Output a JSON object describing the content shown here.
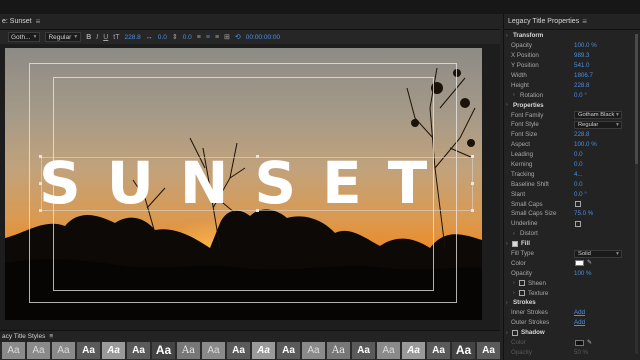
{
  "title_panel": {
    "tab_label": "e: Sunset",
    "menu_glyph": "≡"
  },
  "toolbar": {
    "font_family": "Goth...",
    "font_style": "Regular",
    "bold": "B",
    "italic": "I",
    "underline": "U",
    "font_size_icon": "tT",
    "font_size": "228.8",
    "kerning": "0.0",
    "leading": "0.0",
    "timecode": "00:00:00:00"
  },
  "canvas": {
    "title_text": "SUNSET"
  },
  "styles_panel": {
    "tab_label": "acy Title Styles",
    "menu_glyph": "≡",
    "swatches": [
      "Aa",
      "Aa",
      "Aa",
      "Aa",
      "Aa",
      "Aa",
      "Aa",
      "Aa",
      "Aa",
      "Aa",
      "Aa",
      "Aa",
      "Aa",
      "Aa",
      "Aa",
      "Aa",
      "Aa",
      "Aa",
      "Aa",
      "Aa"
    ]
  },
  "properties_panel": {
    "title": "Legacy Title Properties",
    "menu_glyph": "≡",
    "rows": [
      {
        "kind": "section",
        "label": "Transform"
      },
      {
        "kind": "value",
        "label": "Opacity",
        "value": "100.0 %"
      },
      {
        "kind": "value",
        "label": "X Position",
        "value": "989.3"
      },
      {
        "kind": "value",
        "label": "Y Position",
        "value": "541.0"
      },
      {
        "kind": "value",
        "label": "Width",
        "value": "1806.7"
      },
      {
        "kind": "value",
        "label": "Height",
        "value": "228.8"
      },
      {
        "kind": "twisty",
        "label": "Rotation",
        "value": "0.0 °"
      },
      {
        "kind": "section",
        "label": "Properties"
      },
      {
        "kind": "select",
        "label": "Font Family",
        "value": "Gotham Black"
      },
      {
        "kind": "select",
        "label": "Font Style",
        "value": "Regular"
      },
      {
        "kind": "value",
        "label": "Font Size",
        "value": "228.8"
      },
      {
        "kind": "value",
        "label": "Aspect",
        "value": "100.0 %"
      },
      {
        "kind": "value",
        "label": "Leading",
        "value": "0.0"
      },
      {
        "kind": "value",
        "label": "Kerning",
        "value": "0.0"
      },
      {
        "kind": "value",
        "label": "Tracking",
        "value": "4..."
      },
      {
        "kind": "value",
        "label": "Baseline Shift",
        "value": "0.0"
      },
      {
        "kind": "value",
        "label": "Slant",
        "value": "0.0 °"
      },
      {
        "kind": "check",
        "label": "Small Caps",
        "checked": false
      },
      {
        "kind": "value",
        "label": "Small Caps Size",
        "value": "75.0 %"
      },
      {
        "kind": "check",
        "label": "Underline",
        "checked": false
      },
      {
        "kind": "twisty",
        "label": "Distort",
        "value": ""
      },
      {
        "kind": "section-check",
        "label": "Fill",
        "checked": true
      },
      {
        "kind": "select",
        "label": "Fill Type",
        "value": "Solid"
      },
      {
        "kind": "color",
        "label": "Color",
        "value": ""
      },
      {
        "kind": "value",
        "label": "Opacity",
        "value": "100 %"
      },
      {
        "kind": "twisty-check",
        "label": "Sheen",
        "checked": false
      },
      {
        "kind": "twisty-check",
        "label": "Texture",
        "checked": false
      },
      {
        "kind": "section",
        "label": "Strokes"
      },
      {
        "kind": "link",
        "label": "Inner Strokes",
        "value": "Add"
      },
      {
        "kind": "link",
        "label": "Outer Strokes",
        "value": "Add"
      },
      {
        "kind": "section-check",
        "label": "Shadow",
        "checked": false
      },
      {
        "kind": "color-dim",
        "label": "Color",
        "value": ""
      },
      {
        "kind": "value-dim",
        "label": "Opacity",
        "value": "50 %"
      }
    ]
  },
  "colors": {
    "accent": "#4b8fe3",
    "panel_bg": "#232323",
    "fill_color": "#ffffff"
  },
  "icons": [
    "menu-icon",
    "bold-icon",
    "italic-icon",
    "underline-icon",
    "font-size-icon",
    "kerning-icon",
    "leading-icon",
    "align-left-icon",
    "align-center-icon",
    "align-right-icon",
    "timecode-icon",
    "eyedropper-icon"
  ]
}
